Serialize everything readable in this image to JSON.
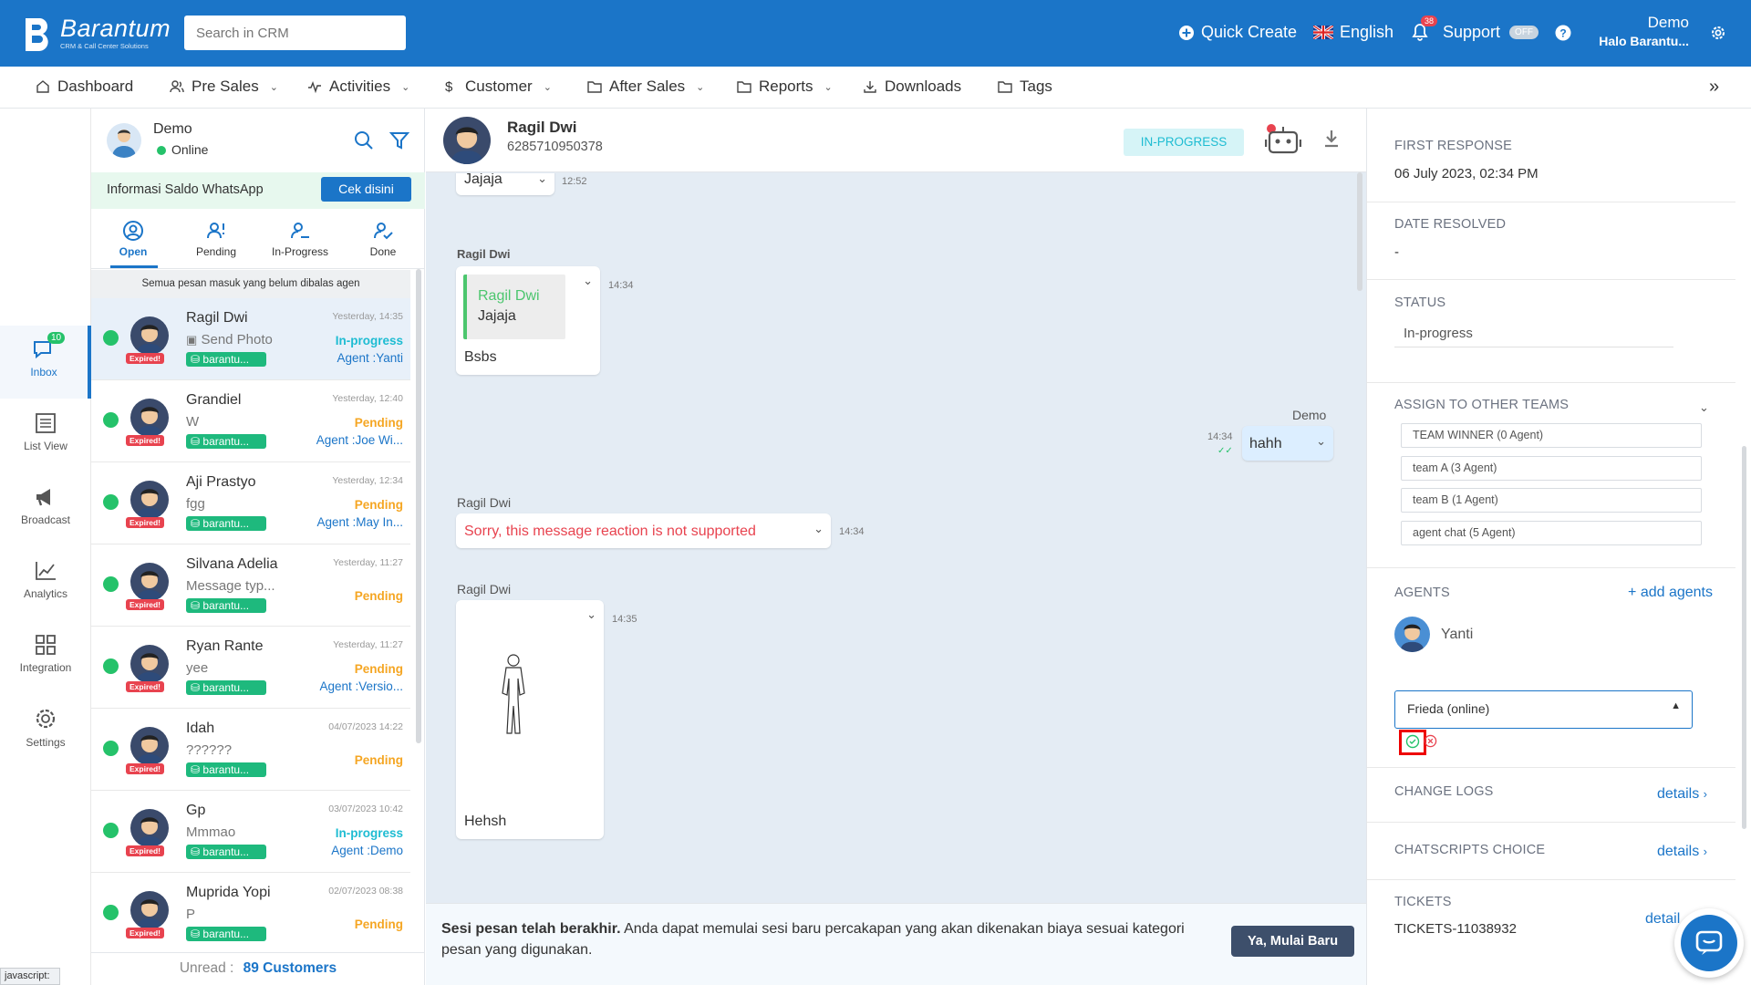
{
  "brand": {
    "name": "Barantum",
    "tagline": "CRM & Call Center Solutions"
  },
  "search": {
    "placeholder": "Search in CRM"
  },
  "topbar": {
    "quick_create": "Quick Create",
    "language": "English",
    "notif_count": "38",
    "support": "Support",
    "support_toggle": "OFF",
    "user_name": "Demo",
    "user_sub": "Halo Barantu..."
  },
  "nav": [
    {
      "label": "Dashboard",
      "icon": "home-icon",
      "dropdown": false
    },
    {
      "label": "Pre Sales",
      "icon": "users-icon",
      "dropdown": true
    },
    {
      "label": "Activities",
      "icon": "activity-icon",
      "dropdown": true
    },
    {
      "label": "Customer",
      "icon": "dollar-icon",
      "dropdown": true
    },
    {
      "label": "After Sales",
      "icon": "folder-icon",
      "dropdown": true
    },
    {
      "label": "Reports",
      "icon": "folder-icon",
      "dropdown": true
    },
    {
      "label": "Downloads",
      "icon": "download-icon",
      "dropdown": false
    },
    {
      "label": "Tags",
      "icon": "folder-icon",
      "dropdown": false
    }
  ],
  "rail": [
    {
      "label": "Inbox",
      "badge": "10",
      "active": true
    },
    {
      "label": "List View"
    },
    {
      "label": "Broadcast"
    },
    {
      "label": "Analytics"
    },
    {
      "label": "Integration"
    },
    {
      "label": "Settings"
    }
  ],
  "agent_profile": {
    "name": "Demo",
    "status": "Online"
  },
  "saldo": {
    "text": "Informasi Saldo WhatsApp",
    "button": "Cek disini"
  },
  "tabs": [
    {
      "label": "Open",
      "active": true
    },
    {
      "label": "Pending"
    },
    {
      "label": "In-Progress"
    },
    {
      "label": "Done"
    }
  ],
  "list_hint": "Semua pesan masuk yang belum dibalas agen",
  "conversations": [
    {
      "name": "Ragil Dwi",
      "message": "Send Photo",
      "tag": "barantu...",
      "time": "Yesterday, 14:35",
      "status": "In-progress",
      "agent": "Agent :Yanti",
      "expired": "Expired!",
      "selected": true
    },
    {
      "name": "Grandiel",
      "message": "W",
      "tag": "barantu...",
      "time": "Yesterday, 12:40",
      "status": "Pending",
      "agent": "Agent :Joe Wi...",
      "expired": "Expired!"
    },
    {
      "name": "Aji Prastyo",
      "message": "fgg",
      "tag": "barantu...",
      "time": "Yesterday, 12:34",
      "status": "Pending",
      "agent": "Agent :May In...",
      "expired": "Expired!"
    },
    {
      "name": "Silvana Adelia",
      "message": "Message typ...",
      "tag": "barantu...",
      "time": "Yesterday, 11:27",
      "status": "Pending",
      "agent": "",
      "expired": "Expired!"
    },
    {
      "name": "Ryan Rante",
      "message": "yee",
      "tag": "barantu...",
      "time": "Yesterday, 11:27",
      "status": "Pending",
      "agent": "Agent :Versio...",
      "expired": "Expired!"
    },
    {
      "name": "Idah",
      "message": "??????",
      "tag": "barantu...",
      "time": "04/07/2023 14:22",
      "status": "Pending",
      "agent": "",
      "expired": "Expired!"
    },
    {
      "name": "Gp",
      "message": "Mmmao",
      "tag": "barantu...",
      "time": "03/07/2023 10:42",
      "status": "In-progress",
      "agent": "Agent :Demo",
      "expired": "Expired!"
    },
    {
      "name": "Muprida Yopi",
      "message": "P",
      "tag": "barantu...",
      "time": "02/07/2023 08:38",
      "status": "Pending",
      "agent": "",
      "expired": "Expired!"
    }
  ],
  "unread": {
    "label": "Unread :",
    "value": "89 Customers"
  },
  "chat": {
    "contact_name": "Ragil Dwi",
    "contact_phone": "6285710950378",
    "status_badge": "IN-PROGRESS",
    "messages": [
      {
        "text": "Jajaja",
        "time": "12:52"
      },
      {
        "sender": "Ragil Dwi",
        "quote_name": "Ragil Dwi",
        "quote_text": "Jajaja",
        "text": "Bsbs",
        "time": "14:34"
      },
      {
        "sender": "Demo",
        "text": "hahh",
        "time": "14:34"
      },
      {
        "sender": "Ragil Dwi",
        "text": "Sorry, this message reaction is not supported",
        "time": "14:34"
      },
      {
        "sender": "Ragil Dwi",
        "text": "Hehsh",
        "time": "14:35"
      }
    ],
    "session_bold": "Sesi pesan telah berakhir.",
    "session_text": " Anda dapat memulai sesi baru percakapan yang akan dikenakan biaya sesuai kategori pesan yang digunakan.",
    "session_button": "Ya, Mulai Baru"
  },
  "details": {
    "first_response_label": "FIRST RESPONSE",
    "first_response": "06 July 2023, 02:34 PM",
    "date_resolved_label": "DATE RESOLVED",
    "date_resolved": "-",
    "status_label": "STATUS",
    "status": "In-progress",
    "assign_label": "ASSIGN TO OTHER TEAMS",
    "teams": [
      "TEAM WINNER (0 Agent)",
      "team A (3 Agent)",
      "team B (1 Agent)",
      "agent chat (5 Agent)"
    ],
    "agents_label": "AGENTS",
    "add_agents": "+ add agents",
    "agent_name": "Yanti",
    "agent_select": "Frieda (online)",
    "change_logs_label": "CHANGE LOGS",
    "chatscripts_label": "CHATSCRIPTS CHOICE",
    "tickets_label": "TICKETS",
    "ticket_id": "TICKETS-11038932",
    "details_link": "details",
    "details_link_cut": "detail"
  },
  "statusbar": "javascript:",
  "colors": {
    "primary": "#1b75c8",
    "whatsapp": "#25c26a",
    "pending": "#f5a623",
    "in_progress": "#1ebcd2",
    "expired": "#e8434f"
  }
}
